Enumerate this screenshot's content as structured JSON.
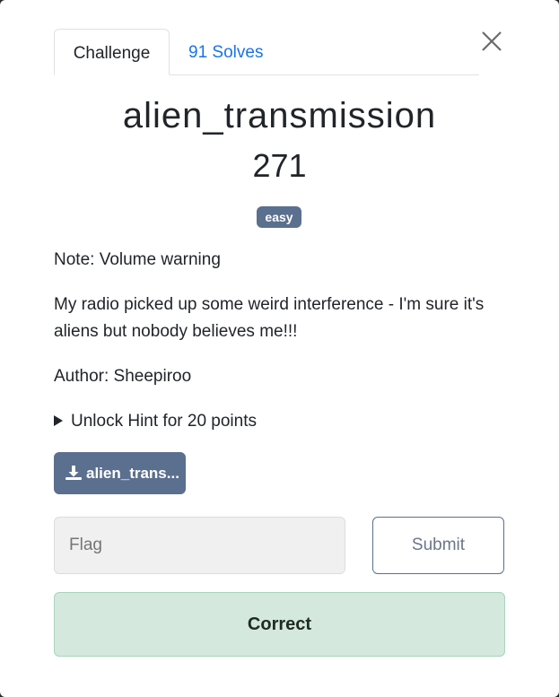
{
  "tabs": {
    "challenge": "Challenge",
    "solves": "91 Solves"
  },
  "challenge": {
    "name": "alien_transmission",
    "value": "271",
    "difficulty": "easy",
    "note": "Note: Volume warning",
    "description": "My radio picked up some weird interference - I'm sure it's aliens but nobody believes me!!!",
    "author": "Author: Sheepiroo",
    "hint": "Unlock Hint for 20 points",
    "file_label": "alien_trans..."
  },
  "form": {
    "flag_placeholder": "Flag",
    "flag_value": "",
    "submit_label": "Submit",
    "result": "Correct"
  },
  "icons": {
    "close": "close-icon",
    "download": "download-icon",
    "hint_toggle": "caret-right-icon"
  },
  "colors": {
    "badge": "#5b6f8e",
    "link": "#1a73e8",
    "success_bg": "#d4e8de",
    "success_border": "#a9d4bb"
  }
}
